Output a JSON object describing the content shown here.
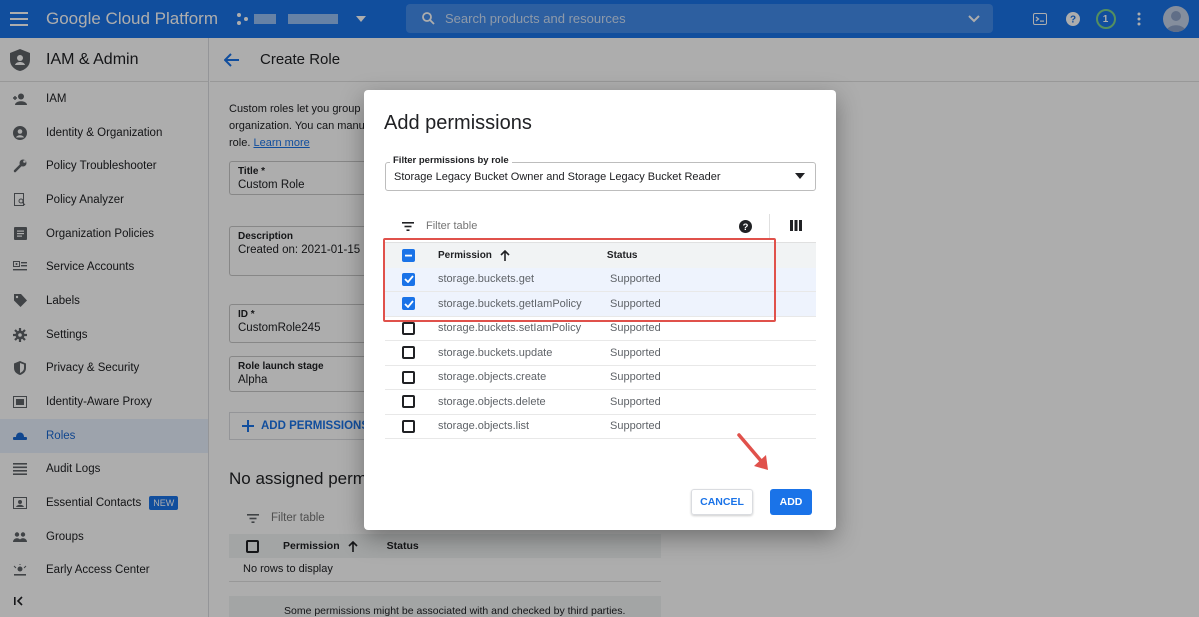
{
  "topbar": {
    "brand": "Google Cloud Platform",
    "search_placeholder": "Search products and resources",
    "notification_count": "1"
  },
  "sidebar": {
    "title": "IAM & Admin",
    "items": [
      {
        "label": "IAM",
        "icon": "person-add-icon"
      },
      {
        "label": "Identity & Organization",
        "icon": "account-circle-icon"
      },
      {
        "label": "Policy Troubleshooter",
        "icon": "wrench-icon"
      },
      {
        "label": "Policy Analyzer",
        "icon": "document-search-icon"
      },
      {
        "label": "Organization Policies",
        "icon": "list-box-icon"
      },
      {
        "label": "Service Accounts",
        "icon": "service-account-icon"
      },
      {
        "label": "Labels",
        "icon": "label-icon"
      },
      {
        "label": "Settings",
        "icon": "gear-icon"
      },
      {
        "label": "Privacy & Security",
        "icon": "shield-icon"
      },
      {
        "label": "Identity-Aware Proxy",
        "icon": "proxy-icon"
      },
      {
        "label": "Roles",
        "icon": "hat-icon"
      },
      {
        "label": "Audit Logs",
        "icon": "lines-icon"
      },
      {
        "label": "Essential Contacts",
        "icon": "contact-card-icon"
      },
      {
        "label": "Groups",
        "icon": "group-icon"
      },
      {
        "label": "Early Access Center",
        "icon": "sparkle-icon"
      }
    ],
    "new_badge": "NEW",
    "active_index": 10
  },
  "main": {
    "page_title": "Create Role",
    "intro_lines": [
      "Custom roles let you group p",
      "organization. You can manu",
      "role."
    ],
    "learn_more": "Learn more",
    "title_label": "Title *",
    "title_value": "Custom Role",
    "description_label": "Description",
    "description_value": "Created on: 2021-01-15",
    "id_label": "ID *",
    "id_value": "CustomRole245",
    "stage_label": "Role launch stage",
    "stage_value": "Alpha",
    "add_permissions_button": "ADD PERMISSIONS",
    "no_assigned_heading": "No assigned perm",
    "mini_filter_placeholder": "Filter table",
    "mini_col_permission": "Permission",
    "mini_col_status": "Status",
    "no_rows": "No rows to display",
    "notice": "Some permissions might be associated with and checked by third parties."
  },
  "dialog": {
    "title": "Add permissions",
    "role_filter_label": "Filter permissions by role",
    "role_filter_value": "Storage Legacy Bucket Owner and Storage Legacy Bucket Reader",
    "filter_placeholder": "Filter table",
    "col_permission": "Permission",
    "col_status": "Status",
    "rows": [
      {
        "permission": "storage.buckets.get",
        "status": "Supported",
        "checked": true
      },
      {
        "permission": "storage.buckets.getIamPolicy",
        "status": "Supported",
        "checked": true
      },
      {
        "permission": "storage.buckets.setIamPolicy",
        "status": "Supported",
        "checked": false
      },
      {
        "permission": "storage.buckets.update",
        "status": "Supported",
        "checked": false
      },
      {
        "permission": "storage.objects.create",
        "status": "Supported",
        "checked": false
      },
      {
        "permission": "storage.objects.delete",
        "status": "Supported",
        "checked": false
      },
      {
        "permission": "storage.objects.list",
        "status": "Supported",
        "checked": false
      }
    ],
    "cancel_button": "CANCEL",
    "add_button": "ADD"
  },
  "colors": {
    "primary": "#1a73e8",
    "annotation": "#e0514b"
  }
}
